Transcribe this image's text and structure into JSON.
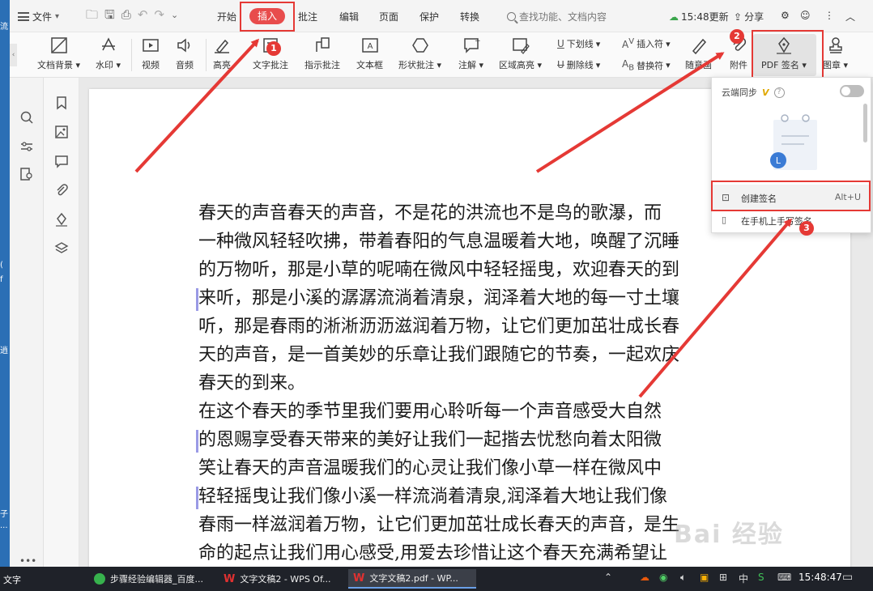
{
  "desktop": {
    "side_chars": [
      "流",
      "(",
      "f",
      "逍",
      "子",
      "...",
      "文字"
    ]
  },
  "menubar": {
    "file": "文件",
    "tabs": [
      "开始",
      "插入",
      "批注",
      "编辑",
      "页面",
      "保护",
      "转换"
    ],
    "search_placeholder": "查找功能、文档内容",
    "update_time": "15:48更新",
    "share": "分享"
  },
  "ribbon": {
    "buttons": [
      "文档背景",
      "水印",
      "视频",
      "音频",
      "高亮",
      "文字批注",
      "指示批注",
      "文本框",
      "形状批注",
      "注解",
      "区域高亮"
    ],
    "small": {
      "underline": "下划线",
      "strike": "删除线",
      "insert_symbol": "插入符",
      "replace_symbol": "替换符"
    },
    "right_buttons": {
      "free_draw": "随意画",
      "attachment": "附件",
      "pdf_sign": "PDF 签名",
      "stamp": "图章"
    }
  },
  "dropdown": {
    "cloud_sync": "云端同步",
    "vip_mark": "V",
    "help": "?",
    "create_sign": "创建签名",
    "shortcut": "Alt+U",
    "phone_sign": "在手机上手写签名"
  },
  "badges": [
    "1",
    "2",
    "3"
  ],
  "document": {
    "lines": [
      "春天的声音春天的声音，不是花的洪流也不是鸟的歌瀑，而",
      "一种微风轻轻吹拂，带着春阳的气息温暖着大地，唤醒了沉睡",
      "的万物听，那是小草的呢喃在微风中轻轻摇曳，欢迎春天的到",
      "来听，那是小溪的潺潺流淌着清泉，润泽着大地的每一寸土壤",
      "听，那是春雨的淅淅沥沥滋润着万物，让它们更加茁壮成长春",
      "天的声音，是一首美妙的乐章让我们跟随它的节奏，一起欢庆",
      "春天的到来。",
      "在这个春天的季节里我们要用心聆听每一个声音感受大自然",
      "的恩赐享受春天带来的美好让我们一起揩去忧愁向着太阳微",
      "笑让春天的声音温暖我们的心灵让我们像小草一样在微风中",
      "轻轻摇曳让我们像小溪一样流淌着清泉,润泽着大地让我们像",
      "春雨一样滋润着万物，让它们更加茁壮成长春天的声音，是生",
      "命的起点让我们用心感受,用爱去珍惜让这个春天充满希望让"
    ]
  },
  "taskbar": {
    "left_label": "文字",
    "tasks": [
      "步骤经验编辑器_百度...",
      "文字文稿2 - WPS Of...",
      "文字文稿2.pdf - WP..."
    ],
    "ime": "中",
    "clock": "15:48:47"
  },
  "watermark": "Bai 经验"
}
